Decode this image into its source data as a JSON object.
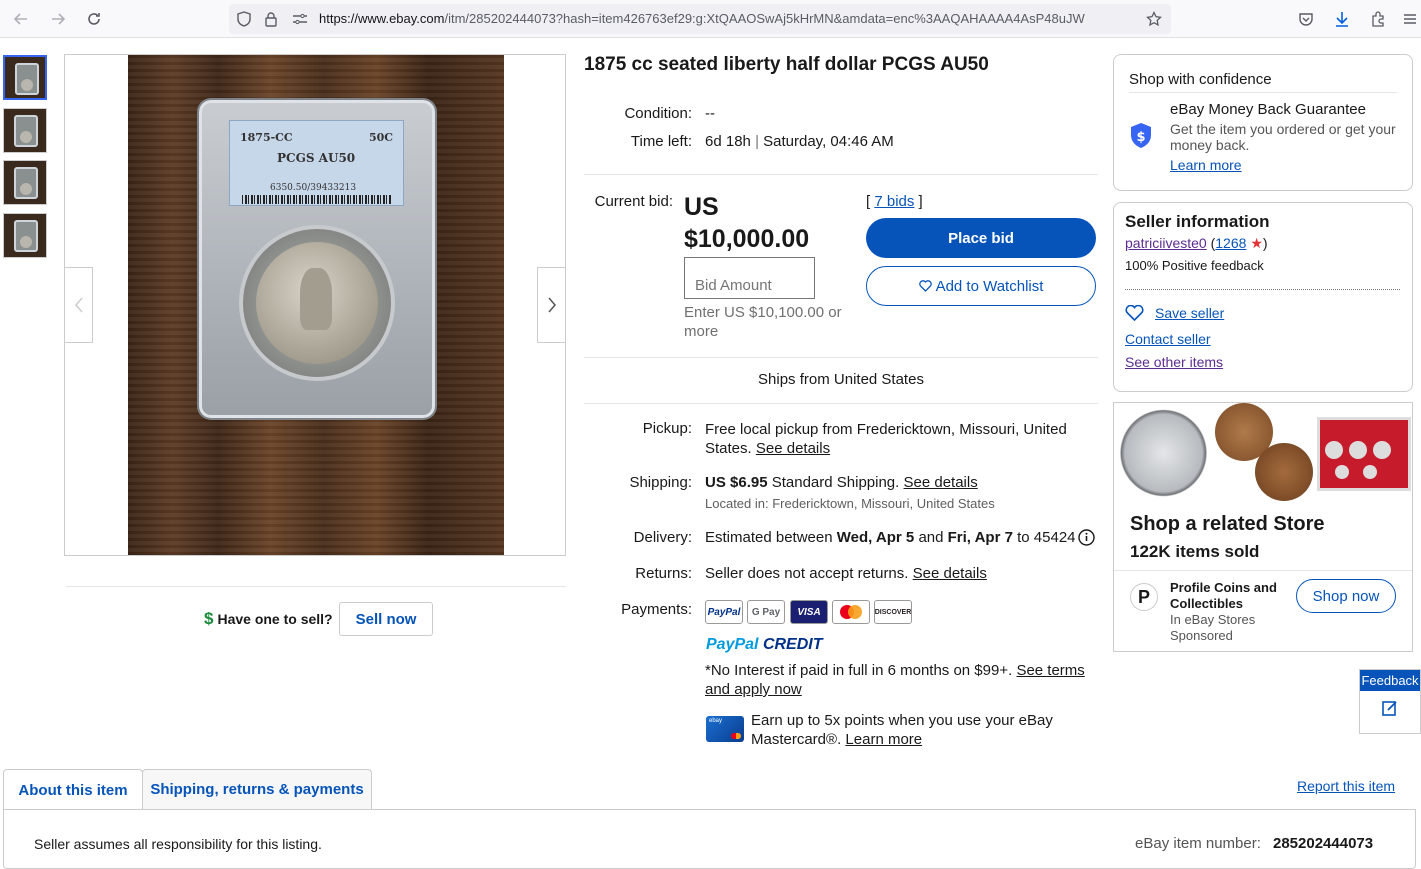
{
  "browser": {
    "url_host": "https://www.ebay.com",
    "url_path": "/itm/285202444073?hash=item426763ef29:g:XtQAAOSwAj5kHrMN&amdata=enc%3AAQAHAAAA4AsP48uJW"
  },
  "gallery": {
    "photo_label": {
      "year": "1875-CC",
      "denom": "50C",
      "grade": "PCGS AU50",
      "cert": "6350.50/39433213"
    }
  },
  "sell": {
    "prompt": "Have one to sell?",
    "button": "Sell now"
  },
  "listing": {
    "title": "1875 cc seated liberty half dollar PCGS AU50",
    "condition_label": "Condition:",
    "condition_value": "--",
    "time_left_label": "Time left:",
    "time_left_value": "6d 18h",
    "time_left_sep": "|",
    "time_left_end": "Saturday, 04:46 AM",
    "current_bid_label": "Current bid:",
    "currency": "US",
    "amount": "$10,000.00",
    "bids_open": "[",
    "bids_count": "7 bids",
    "bids_close": "]",
    "bid_placeholder": "Bid Amount",
    "bid_hint": "Enter US $10,100.00 or more",
    "place_bid": "Place bid",
    "watchlist": "Add to Watchlist",
    "ships_from": "Ships from United States"
  },
  "details": {
    "pickup_label": "Pickup:",
    "pickup_text": "Free local pickup from Fredericktown, Missouri, United States.",
    "pickup_link": "See details",
    "shipping_label": "Shipping:",
    "shipping_price": "US $6.95",
    "shipping_method": "Standard Shipping.",
    "shipping_link": "See details",
    "located": "Located in: Fredericktown, Missouri, United States",
    "delivery_label": "Delivery:",
    "delivery_pre": "Estimated between",
    "delivery_from": "Wed, Apr 5",
    "delivery_and": "and",
    "delivery_to": "Fri, Apr 7",
    "delivery_zip": "to 45424",
    "returns_label": "Returns:",
    "returns_text": "Seller does not accept returns.",
    "returns_link": "See details",
    "payments_label": "Payments:",
    "payment_methods": [
      "PayPal",
      "G Pay",
      "VISA",
      "",
      "DISCOVER"
    ],
    "paypal_credit_a": "PayPal",
    "paypal_credit_b": "CREDIT",
    "no_interest": "*No Interest if paid in full in 6 months on $99+.",
    "no_interest_link": "See terms and apply now",
    "mastercard_text": "Earn up to 5x points when you use your eBay Mastercard®.",
    "mastercard_link": "Learn more"
  },
  "confidence": {
    "title": "Shop with confidence",
    "guarantee_title": "eBay Money Back Guarantee",
    "guarantee_text": "Get the item you ordered or get your money back.",
    "learn_more": "Learn more"
  },
  "seller": {
    "title": "Seller information",
    "name": "patriciiveste0",
    "feedback_open": "(",
    "feedback_count": "1268",
    "feedback_close": ")",
    "positive": "100% Positive feedback",
    "save": "Save seller",
    "contact": "Contact seller",
    "other": "See other items"
  },
  "store_ad": {
    "headline": "Shop a related Store",
    "sold": "122K items sold",
    "store_name": "Profile Coins and Collectibles",
    "store_sub": "In eBay Stores",
    "sponsored": "Sponsored",
    "shop_now": "Shop now"
  },
  "feedback_tab": {
    "label": "Feedback"
  },
  "tabs": [
    {
      "label": "About this item"
    },
    {
      "label": "Shipping, returns & payments"
    }
  ],
  "report": "Report this item",
  "footer": {
    "responsibility": "Seller assumes all responsibility for this listing.",
    "item_number_label": "eBay item number:",
    "item_number": "285202444073"
  },
  "colors": {
    "primary": "#0654ba",
    "seller_link": "#5c2c91"
  }
}
